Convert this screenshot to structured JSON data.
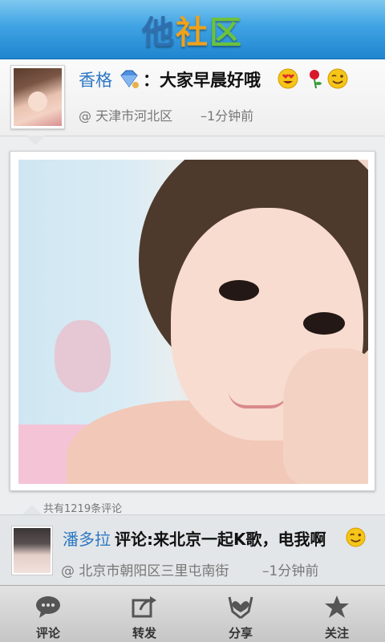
{
  "app": {
    "title_parts": [
      "他",
      "社",
      "区"
    ]
  },
  "post": {
    "username": "香格",
    "text": "：大家早晨好哦",
    "location": "@ 天津市河北区",
    "time": "–1分钟前",
    "badge_icon": "gem-icon",
    "emoticons": [
      "heart-eyes-icon",
      "rose-icon",
      "wink-icon"
    ]
  },
  "comments": {
    "count_text": "共有1219条评论",
    "latest": {
      "username": "潘多拉",
      "text": "评论:来北京一起K歌，电我啊",
      "location": "@ 北京市朝阳区三里屯南街",
      "time": "–1分钟前",
      "emoticon": "wink-icon"
    }
  },
  "toolbar": {
    "comment_label": "评论",
    "forward_label": "转发",
    "share_label": "分享",
    "follow_label": "关注"
  },
  "colors": {
    "header_blue": "#2f8fd8",
    "username_blue": "#2d78c4",
    "title_orange": "#f0a21a",
    "title_green": "#6cc23a"
  }
}
